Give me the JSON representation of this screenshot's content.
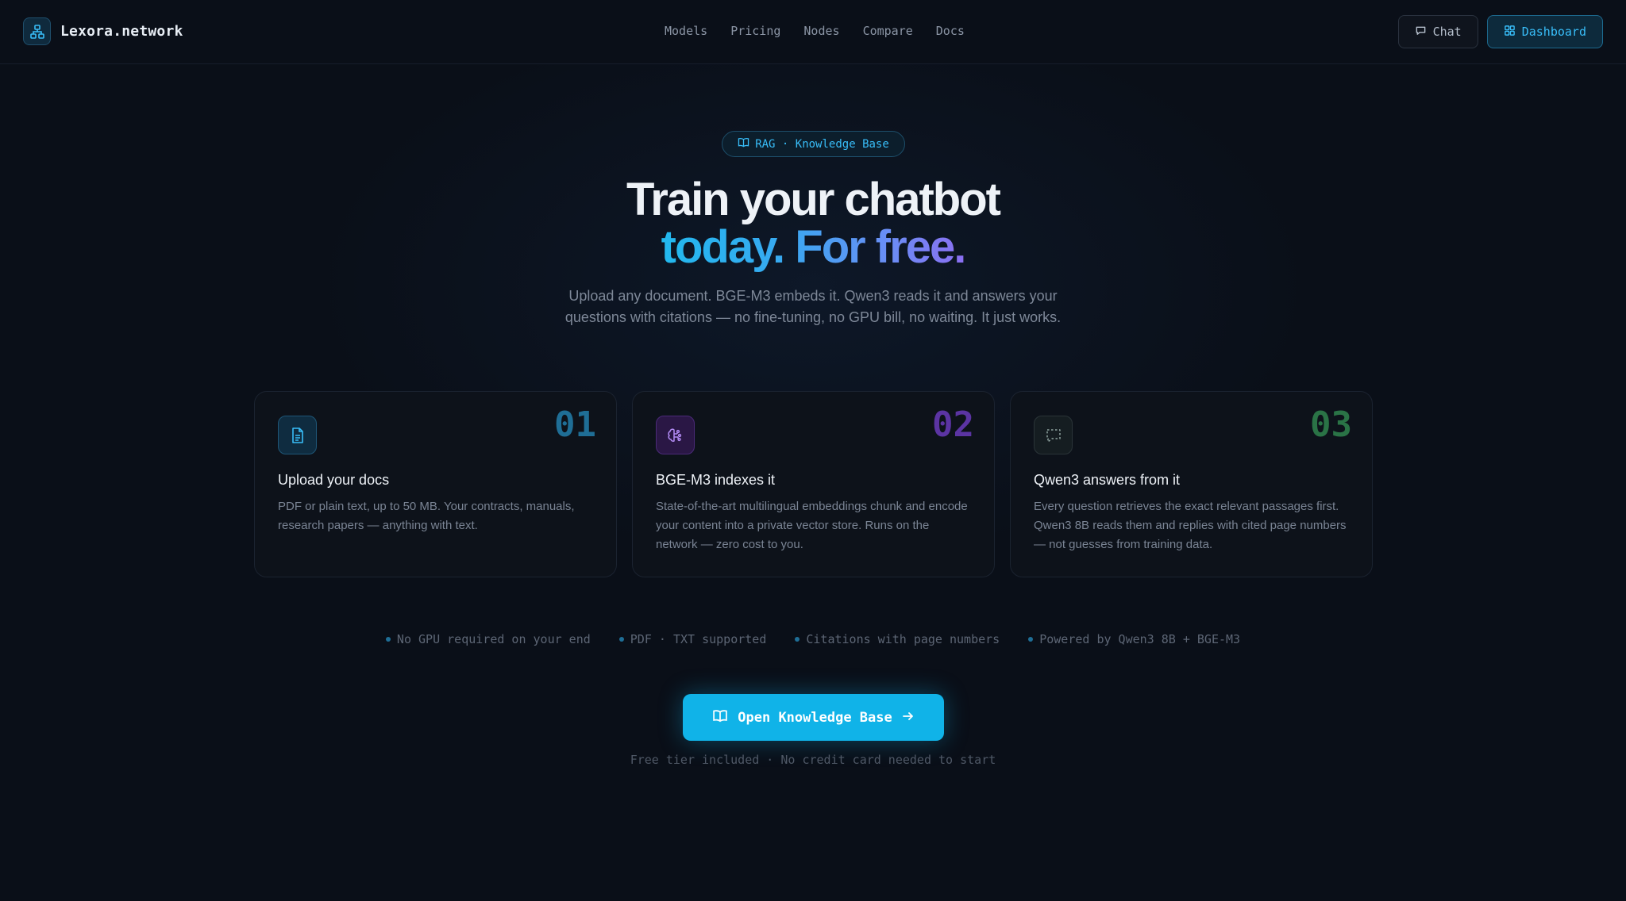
{
  "nav": {
    "brand": "Lexora.network",
    "links": [
      "Models",
      "Pricing",
      "Nodes",
      "Compare",
      "Docs"
    ],
    "chat_label": "Chat",
    "dashboard_label": "Dashboard"
  },
  "hero": {
    "pill": "RAG · Knowledge Base",
    "title_line1": "Train your chatbot",
    "title_line2": "today. For free.",
    "subtitle_line1": "Upload any document. BGE-M3 embeds it. Qwen3 reads it and answers your",
    "subtitle_line2": "questions with citations — no fine-tuning, no GPU bill, no waiting. It just works."
  },
  "cards": [
    {
      "num": "01",
      "title": "Upload your docs",
      "desc": "PDF or plain text, up to 50 MB. Your contracts, manuals, research papers — anything with text.",
      "icon": "document-icon",
      "accent": "#1f7aa8"
    },
    {
      "num": "02",
      "title": "BGE-M3 indexes it",
      "desc": "State-of-the-art multilingual embeddings chunk and encode your content into a private vector store. Runs on the network — zero cost to you.",
      "icon": "brain-icon",
      "accent": "#6b3bb8"
    },
    {
      "num": "03",
      "title": "Qwen3 answers from it",
      "desc": "Every question retrieves the exact relevant passages first. Qwen3 8B reads them and replies with cited page numbers — not guesses from training data.",
      "icon": "message-dashed-icon",
      "accent": "#2f7d4a"
    }
  ],
  "features": [
    "No GPU required on your end",
    "PDF · TXT supported",
    "Citations with page numbers",
    "Powered by Qwen3 8B + BGE-M3"
  ],
  "cta": {
    "label": "Open Knowledge Base",
    "note": "Free tier included · No credit card needed to start"
  },
  "colors": {
    "background": "#0a0f18",
    "accent": "#10b3e8",
    "gradient_start": "#22b8ee",
    "gradient_end": "#8b6ff2"
  }
}
